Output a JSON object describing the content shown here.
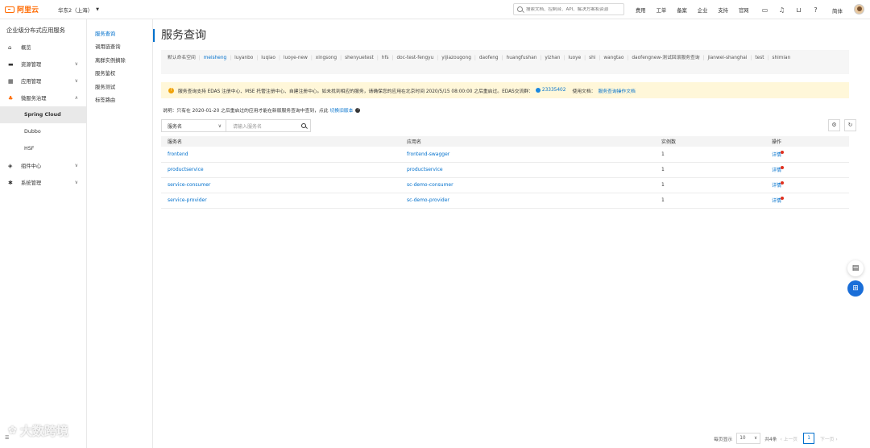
{
  "topbar": {
    "logo": "阿里云",
    "region": "华东2（上海）",
    "search_placeholder": "搜索文档、控制台、API、解决方案和资源",
    "nav": [
      "费用",
      "工单",
      "备案",
      "企业",
      "支持",
      "官网"
    ],
    "icons": [
      "terminal-icon",
      "bell-icon",
      "cart-icon",
      "help-icon"
    ],
    "lang": "简体"
  },
  "sidebar": {
    "title": "企业级分布式应用服务",
    "items": [
      {
        "icon": "home-icon",
        "label": "概览"
      },
      {
        "icon": "folder-icon",
        "label": "资源管理"
      },
      {
        "icon": "apps-icon",
        "label": "应用管理"
      },
      {
        "icon": "microservice-icon",
        "label": "微服务治理"
      }
    ],
    "subitems": [
      "Spring Cloud",
      "Dubbo",
      "HSF"
    ],
    "items2": [
      {
        "icon": "layers-icon",
        "label": "组件中心"
      },
      {
        "icon": "gear-icon",
        "label": "系统管理"
      }
    ]
  },
  "subnav": [
    "服务查询",
    "调用链查询",
    "离群实例摘除",
    "服务鉴权",
    "服务测试",
    "标签路由"
  ],
  "page": {
    "title": "服务查询",
    "namespaces": [
      "默认命名空间",
      "meisheng",
      "luyanbo",
      "luqiao",
      "luoye-new",
      "xingsong",
      "shenyuetest",
      "hfs",
      "doc-test-fengyu",
      "yijiazougong",
      "daofeng",
      "huangfushan",
      "yizhan",
      "luoye",
      "shi",
      "wangtao",
      "daofengnew-测试回滚服务查询",
      "jianwei-shanghai",
      "test",
      "shimian"
    ],
    "active_namespace": "meisheng",
    "alert_text": "服务查询支持 EDAS 注册中心、MSE 托管注册中心、自建注册中心。如未找到相应的服务，请确保您的应用在北京时间 2020/5/15 08:00:00 之后重启过。EDAS交流群：",
    "alert_group": "23335402",
    "alert_doc_prefix": "使用文档：",
    "alert_doc_link": "服务查询操作文档",
    "note_text": "说明：只有在 2020-01-20 之后重启过的应用才能在新版服务查询中查到，点此",
    "note_link": "切换旧版本",
    "filter_select": "服务名",
    "filter_placeholder": "请输入服务名",
    "table": {
      "headers": [
        "服务名",
        "应用名",
        "实例数",
        "操作"
      ],
      "rows": [
        [
          "frontend",
          "frontend-swagger",
          "1",
          "详情"
        ],
        [
          "productservice",
          "productservice",
          "1",
          "详情"
        ],
        [
          "service-consumer",
          "sc-demo-consumer",
          "1",
          "详情"
        ],
        [
          "service-provider",
          "sc-demo-provider",
          "1",
          "详情"
        ]
      ]
    },
    "pager": {
      "per_page_label": "每页显示",
      "per_page": "10",
      "total": "共4条",
      "prev": "上一页",
      "current": "1",
      "next": "下一页"
    }
  },
  "watermark": "大数跨境"
}
